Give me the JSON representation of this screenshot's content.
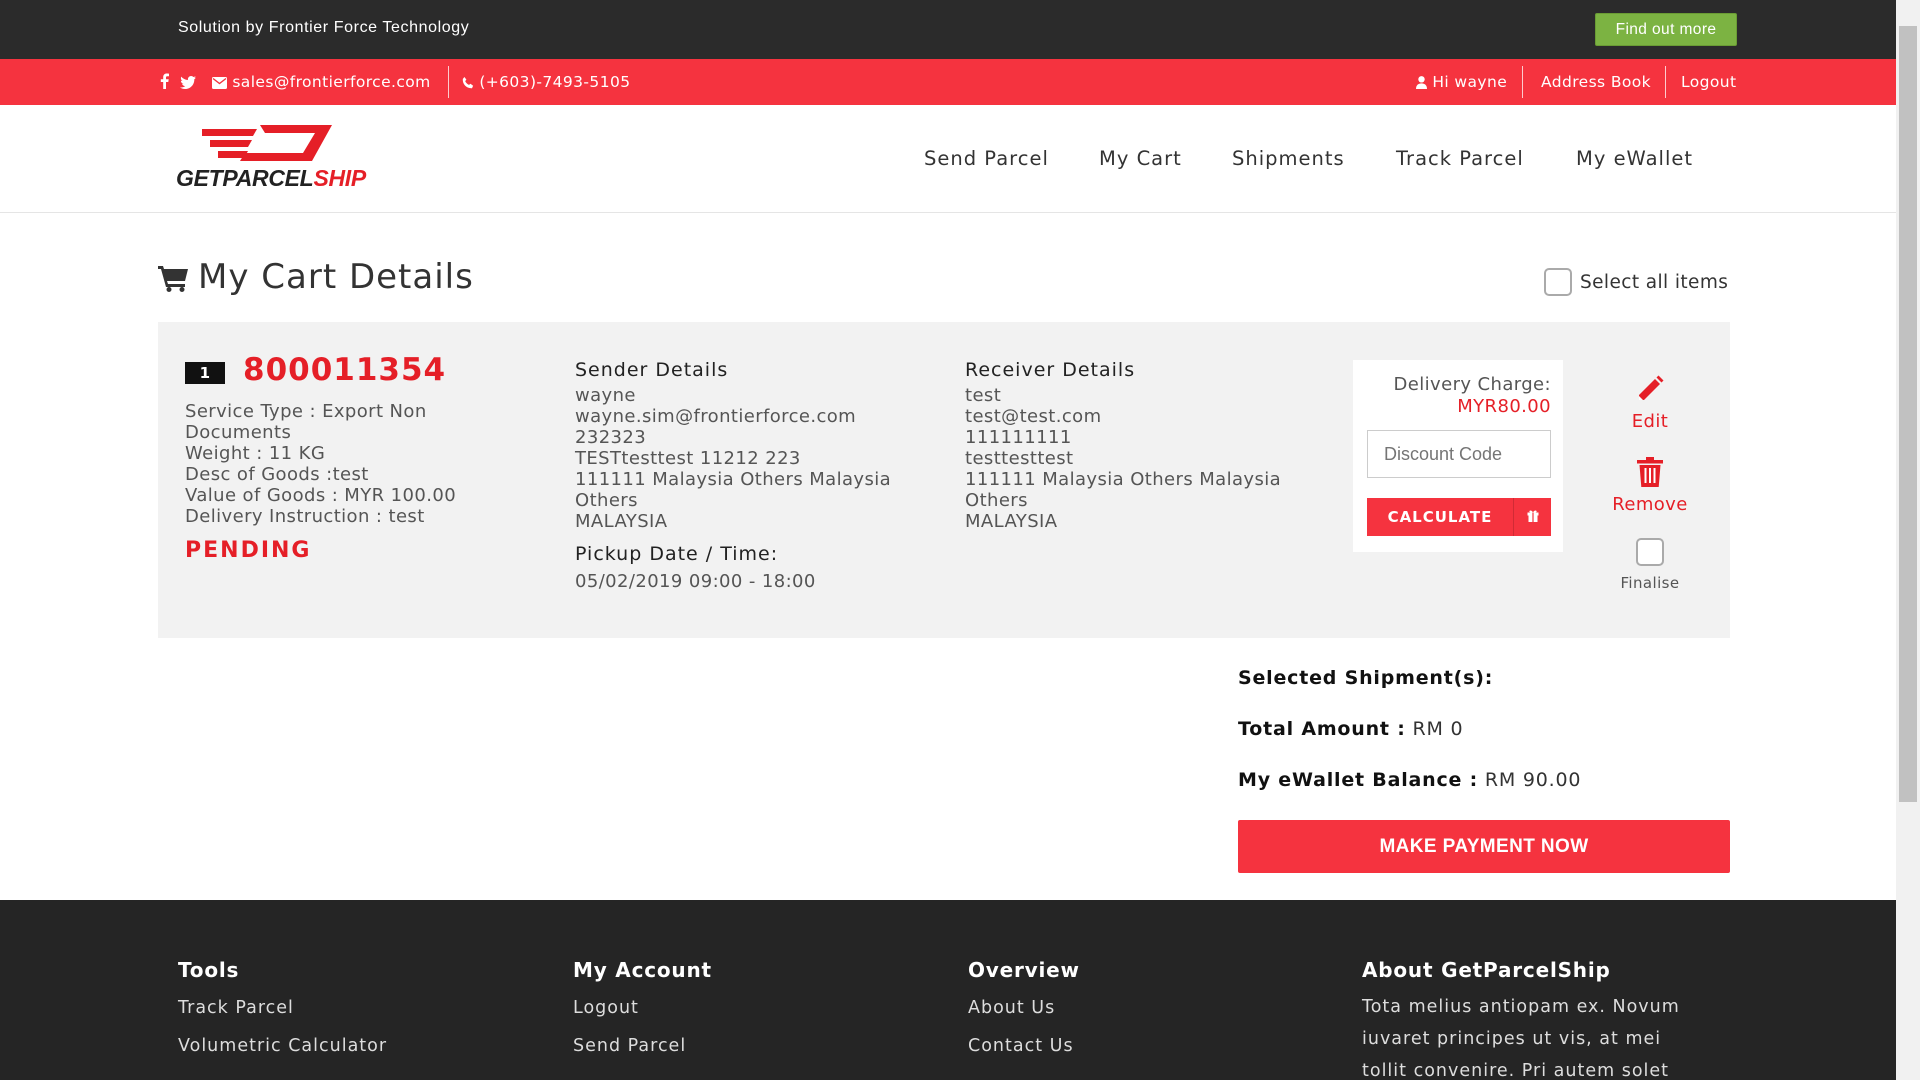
{
  "topbar": {
    "brand": "Solution by Frontier Force Technology",
    "find_out": "Find out more"
  },
  "contact": {
    "email": "sales@frontierforce.com",
    "phone": "(+603)-7493-5105"
  },
  "account": {
    "greeting": "Hi wayne",
    "address_book": "Address Book",
    "logout": "Logout"
  },
  "logo": {
    "part1": "GETPARCEL",
    "part2": "SHIP"
  },
  "nav": [
    "Send Parcel",
    "My Cart",
    "Shipments",
    "Track Parcel",
    "My eWallet"
  ],
  "page": {
    "title": "My Cart Details",
    "select_all": "Select all items"
  },
  "cart_item": {
    "index": "1",
    "awb": "800011354",
    "info": [
      "Service Type : Export Non Documents",
      "Weight : 11 KG",
      "Desc of Goods :test",
      "Value of Goods : MYR 100.00",
      "Delivery Instruction : test"
    ],
    "status": "PENDING",
    "sender": {
      "title": "Sender Details",
      "lines": [
        "wayne",
        "wayne.sim@frontierforce.com",
        "232323",
        "TESTtesttest 11212 223",
        "111111 Malaysia Others Malaysia Others",
        "MALAYSIA"
      ]
    },
    "pickup": {
      "title": "Pickup Date / Time:",
      "value": "05/02/2019 09:00 - 18:00"
    },
    "receiver": {
      "title": "Receiver Details",
      "lines": [
        "test",
        "test@test.com",
        "111111111",
        "testtesttest",
        "111111 Malaysia Others Malaysia Others",
        "MALAYSIA"
      ]
    },
    "charge": {
      "label": "Delivery Charge:",
      "amount": "MYR80.00",
      "discount_placeholder": "Discount Code",
      "calculate": "CALCULATE"
    },
    "actions": {
      "edit": "Edit",
      "remove": "Remove",
      "finalise": "Finalise"
    }
  },
  "summary": {
    "selected_label": "Selected Shipment(s):",
    "total_label": "Total Amount :",
    "total_value": "RM 0",
    "wallet_label": "My eWallet Balance :",
    "wallet_value": "RM 90.00",
    "pay_button": "MAKE PAYMENT NOW"
  },
  "footer": {
    "tools": {
      "title": "Tools",
      "links": [
        "Track Parcel",
        "Volumetric Calculator"
      ]
    },
    "account": {
      "title": "My Account",
      "links": [
        "Logout",
        "Send Parcel"
      ]
    },
    "overview": {
      "title": "Overview",
      "links": [
        "About Us",
        "Contact Us"
      ]
    },
    "about": {
      "title": "About GetParcelShip",
      "text": "Tota melius antiopam ex. Novum iuvaret principes ut vis, at mei tollit convenire. Pri autem solet delicata cu"
    }
  },
  "colors": {
    "accent": "#f5333f",
    "brand_red": "#e51f27",
    "dark": "#2b2b2b",
    "find_out_green": "#7cb342"
  }
}
